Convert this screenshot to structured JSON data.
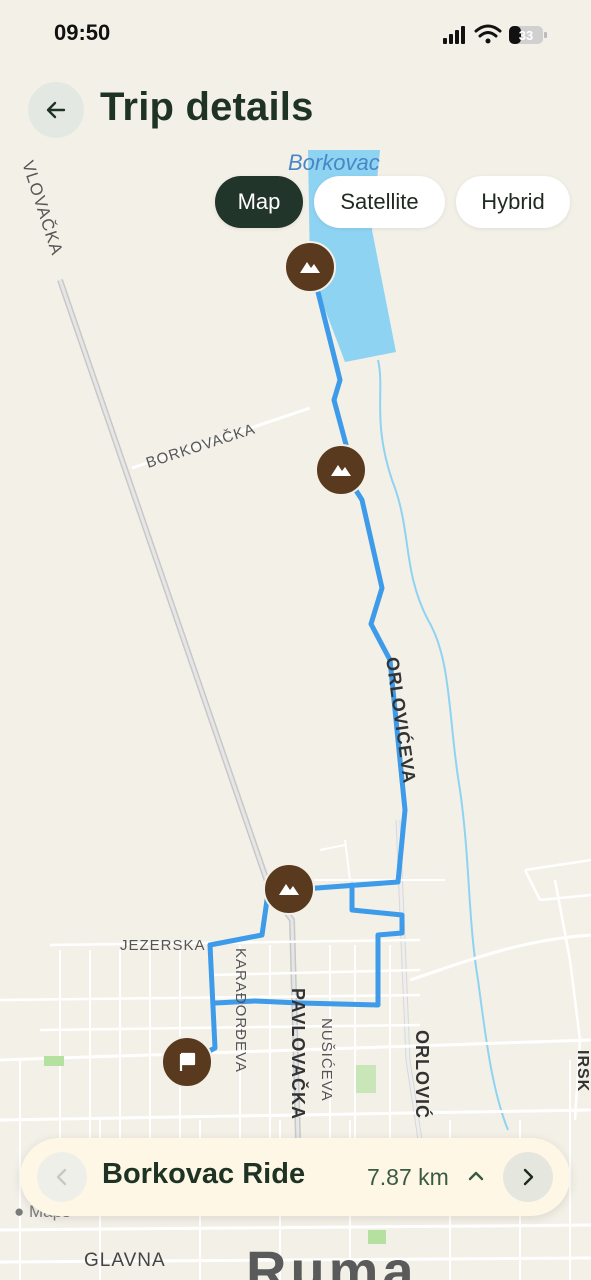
{
  "status_bar": {
    "time": "09:50",
    "battery": "33"
  },
  "header": {
    "title": "Trip details"
  },
  "map_modes": [
    {
      "label": "Map",
      "active": true
    },
    {
      "label": "Satellite",
      "active": false
    },
    {
      "label": "Hybrid",
      "active": false
    }
  ],
  "map": {
    "place_labels": {
      "top_village": "Borkovac",
      "town": "Ruma"
    },
    "street_labels": {
      "vlovacka": "VLOVAČKA",
      "borkovacka": "BORKOVAČKA",
      "orloviceva": "ORLOVIĆEVA",
      "jezerska": "JEZERSKA",
      "karadjordjeva": "KARAĐORĐEVA",
      "pavlovacka": "PAVLOVAČKA",
      "nusiceva": "NUŠIĆEVA",
      "orlovic_partial": "ORLOVIĆ",
      "irsk_partial": "IRSK",
      "glavna": "GLAVNA"
    },
    "markers": [
      {
        "type": "mountain-icon"
      },
      {
        "type": "mountain-icon"
      },
      {
        "type": "mountain-icon"
      },
      {
        "type": "flag-icon"
      }
    ],
    "credit": "Maps",
    "route_color": "#3d9be9",
    "marker_color": "#5a3a1e"
  },
  "trip_card": {
    "name": "Borkovac Ride",
    "distance": "7.87 km"
  }
}
